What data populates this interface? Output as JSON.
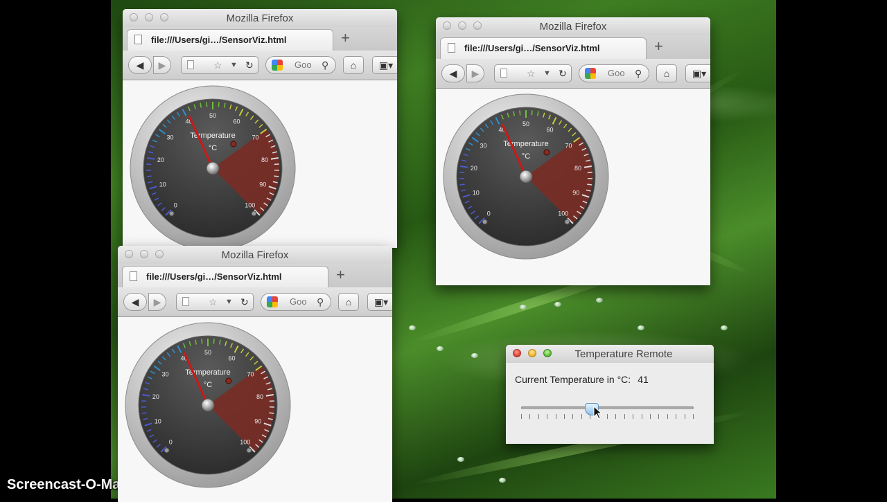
{
  "browser_window": {
    "title": "Mozilla Firefox",
    "tab_title": "file:///Users/gi…/SensorViz.html",
    "new_tab_symbol": "+",
    "search_engine_label": "Goo",
    "icons": [
      "back-arrow-icon",
      "forward-arrow-icon",
      "page-icon",
      "bookmark-star-icon",
      "dropdown-caret-icon",
      "reload-icon",
      "google-icon",
      "search-icon",
      "home-icon",
      "bookmarks-icon"
    ]
  },
  "gauge": {
    "title": "Termperature",
    "unit": "°C",
    "tick_labels": [
      "0",
      "10",
      "20",
      "30",
      "40",
      "50",
      "60",
      "70",
      "80",
      "90",
      "100"
    ],
    "min": 0,
    "max": 100,
    "current_value": 41,
    "red_zone_start": 70,
    "colors": {
      "red_zone": "#7a2c26",
      "needle": "#cc1818",
      "bezel": "#b8b8b8",
      "face": "#3c3c3c"
    }
  },
  "remote": {
    "title": "Temperature Remote",
    "label": "Current Temperature in °C:",
    "value": "41",
    "slider_value": 41,
    "slider_min": 0,
    "slider_max": 100
  },
  "watermark": "Screencast-O-Matic.com"
}
